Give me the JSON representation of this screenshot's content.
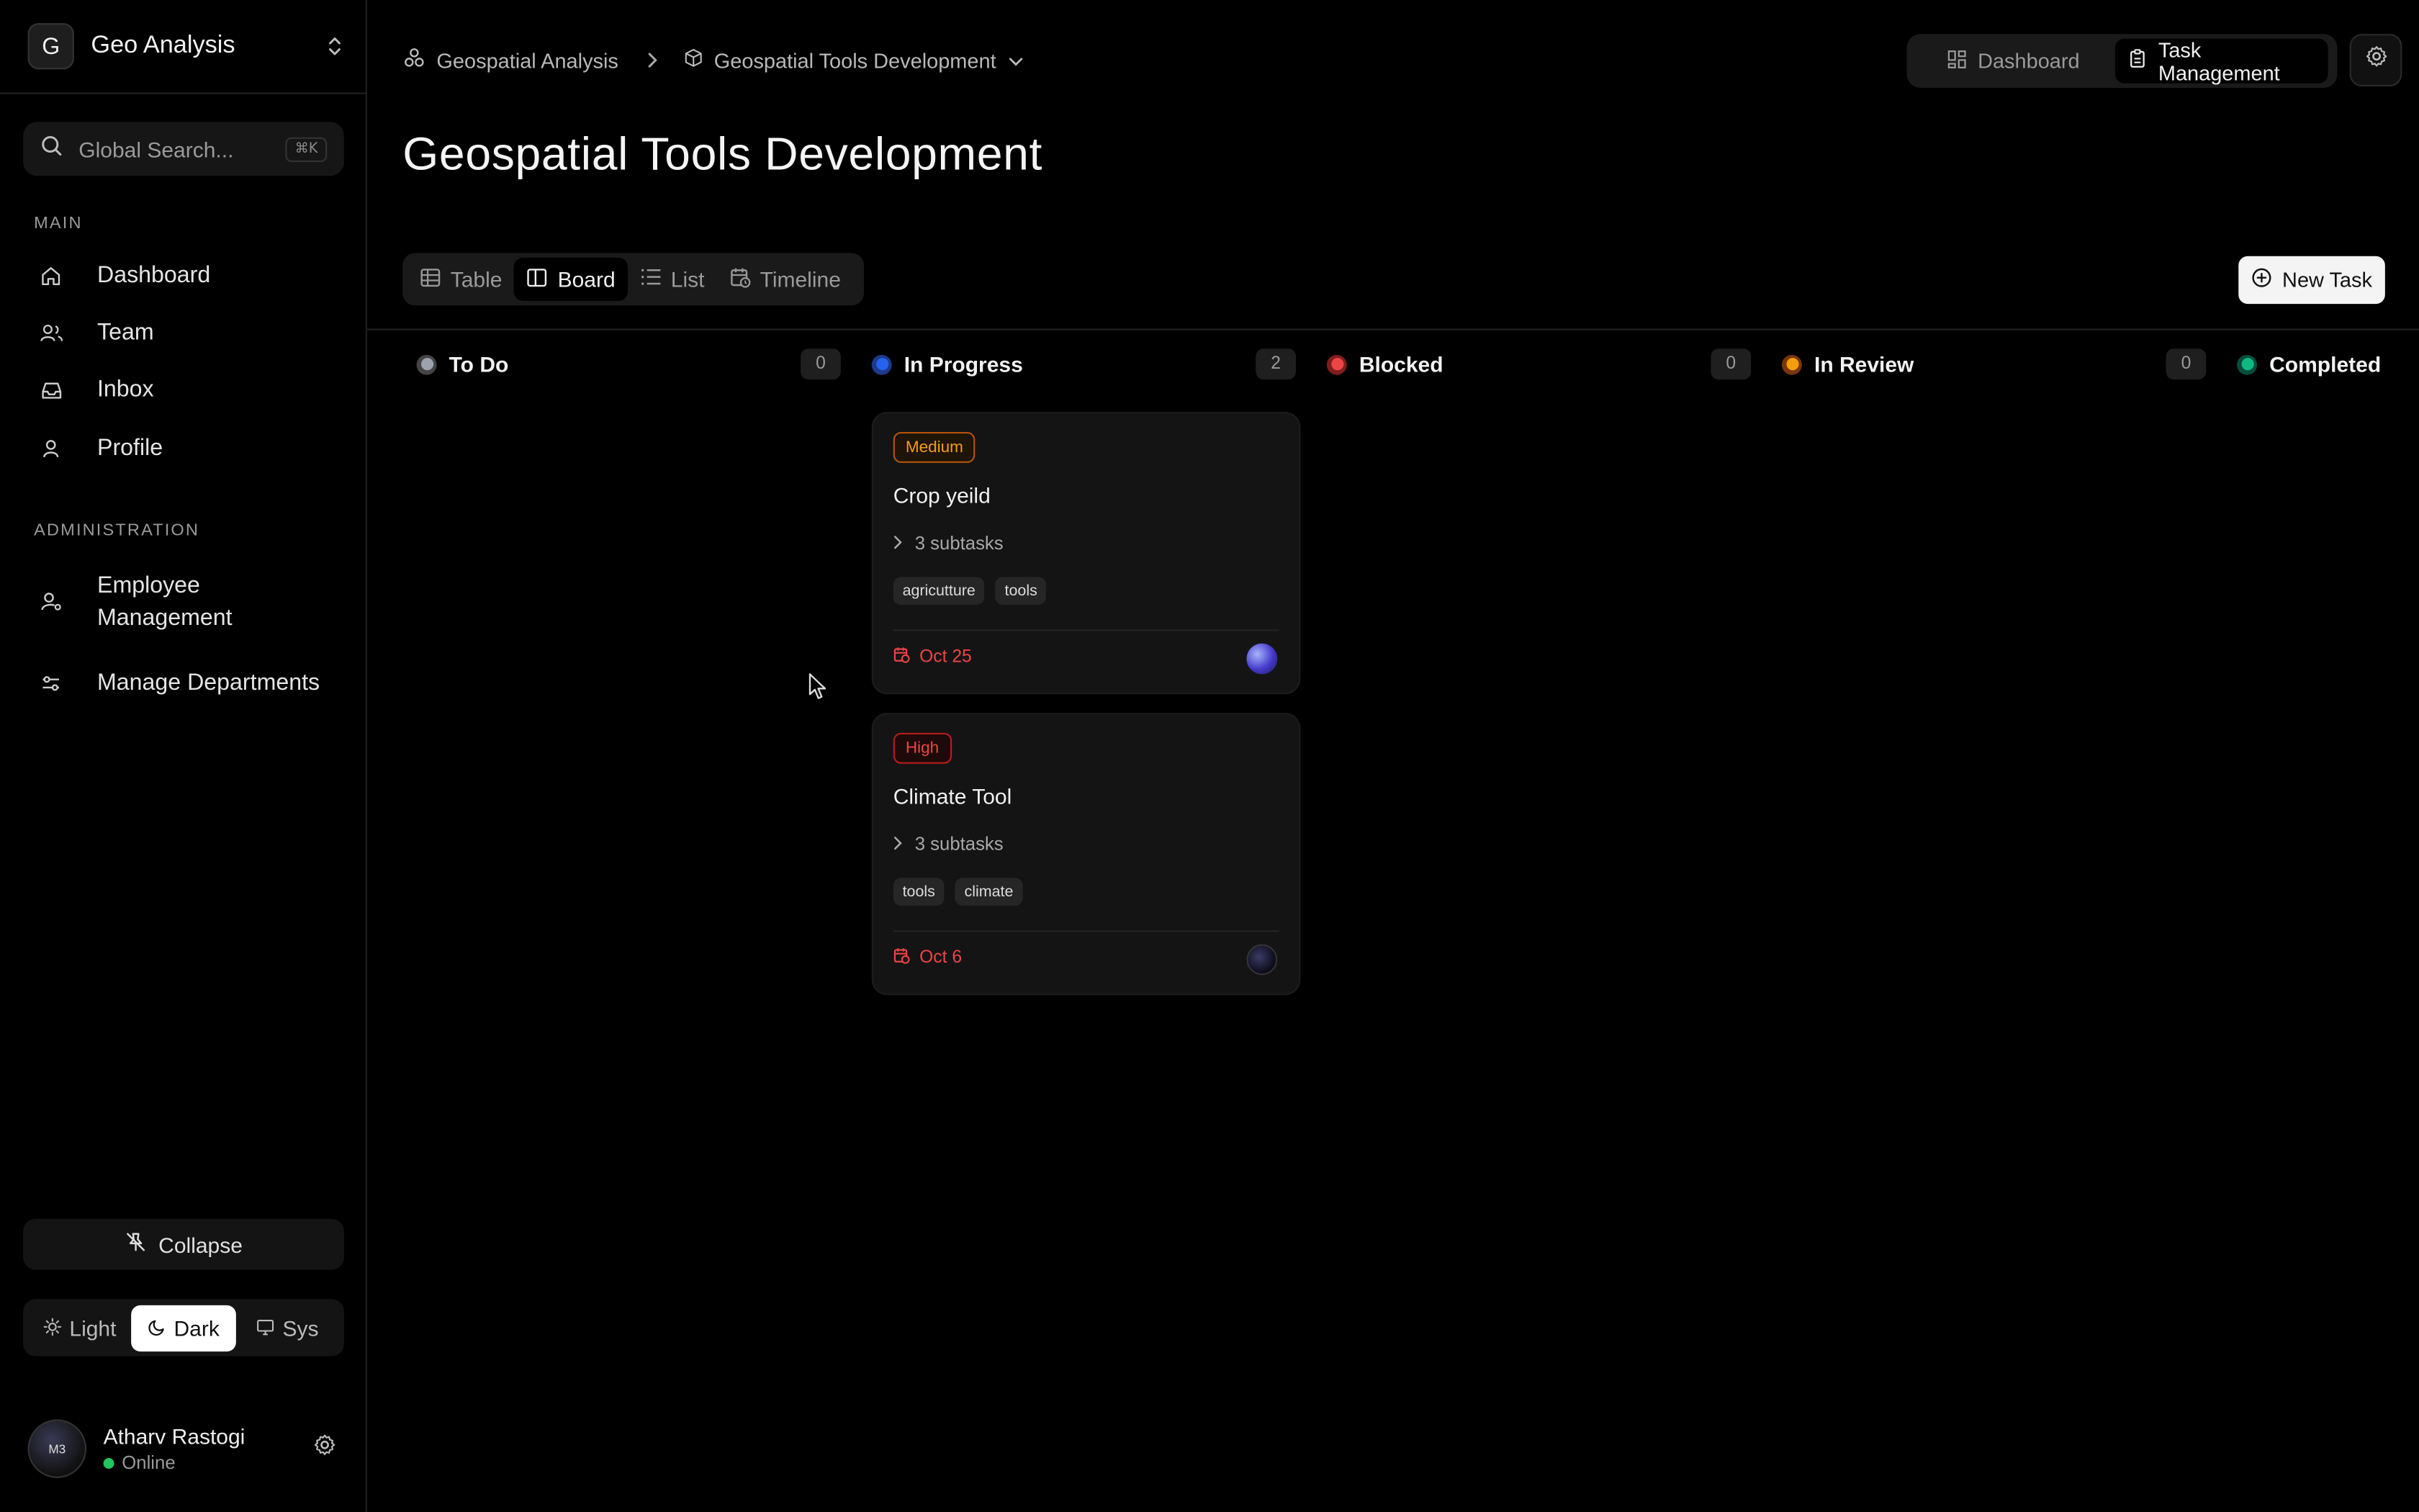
{
  "workspace": {
    "initial": "G",
    "name": "Geo Analysis"
  },
  "search": {
    "placeholder": "Global Search...",
    "shortcut": "⌘K"
  },
  "sidebar": {
    "main_label": "MAIN",
    "main_items": [
      {
        "label": "Dashboard",
        "icon": "home-icon"
      },
      {
        "label": "Team",
        "icon": "users-icon"
      },
      {
        "label": "Inbox",
        "icon": "inbox-icon"
      },
      {
        "label": "Profile",
        "icon": "user-icon"
      }
    ],
    "admin_label": "ADMINISTRATION",
    "admin_items": [
      {
        "label": "Employee\nManagement",
        "line1": "Employee",
        "line2": "Management",
        "icon": "user-cog-icon"
      },
      {
        "label": "Manage Departments",
        "icon": "sliders-icon"
      }
    ],
    "collapse_label": "Collapse",
    "theme": {
      "light": "Light",
      "dark": "Dark",
      "sys": "Sys",
      "selected": "Dark"
    }
  },
  "user": {
    "name": "Atharv Rastogi",
    "status": "Online",
    "avatar_text": "M3"
  },
  "breadcrumb": {
    "project": "Geospatial Analysis",
    "board": "Geospatial Tools Development"
  },
  "top_nav": {
    "dashboard": "Dashboard",
    "task_management": "Task Management",
    "active": "Task Management"
  },
  "page": {
    "title": "Geospatial Tools Development"
  },
  "views": {
    "table": "Table",
    "board": "Board",
    "list": "List",
    "timeline": "Timeline",
    "active": "Board"
  },
  "new_task_label": "New Task",
  "columns": [
    {
      "title": "To Do",
      "count": "0",
      "color": "#9ca3af"
    },
    {
      "title": "In Progress",
      "count": "2",
      "color": "#2563eb"
    },
    {
      "title": "Blocked",
      "count": "0",
      "color": "#ef4444"
    },
    {
      "title": "In Review",
      "count": "0",
      "color": "#f59e0b"
    },
    {
      "title": "Completed",
      "count": "",
      "color": "#10b981"
    }
  ],
  "cards": [
    {
      "priority": "Medium",
      "title": "Crop yeild",
      "subtasks": "3 subtasks",
      "tags": [
        "agricutture",
        "tools"
      ],
      "due": "Oct 25"
    },
    {
      "priority": "High",
      "title": "Climate Tool",
      "subtasks": "3 subtasks",
      "tags": [
        "tools",
        "climate"
      ],
      "due": "Oct 6"
    }
  ]
}
